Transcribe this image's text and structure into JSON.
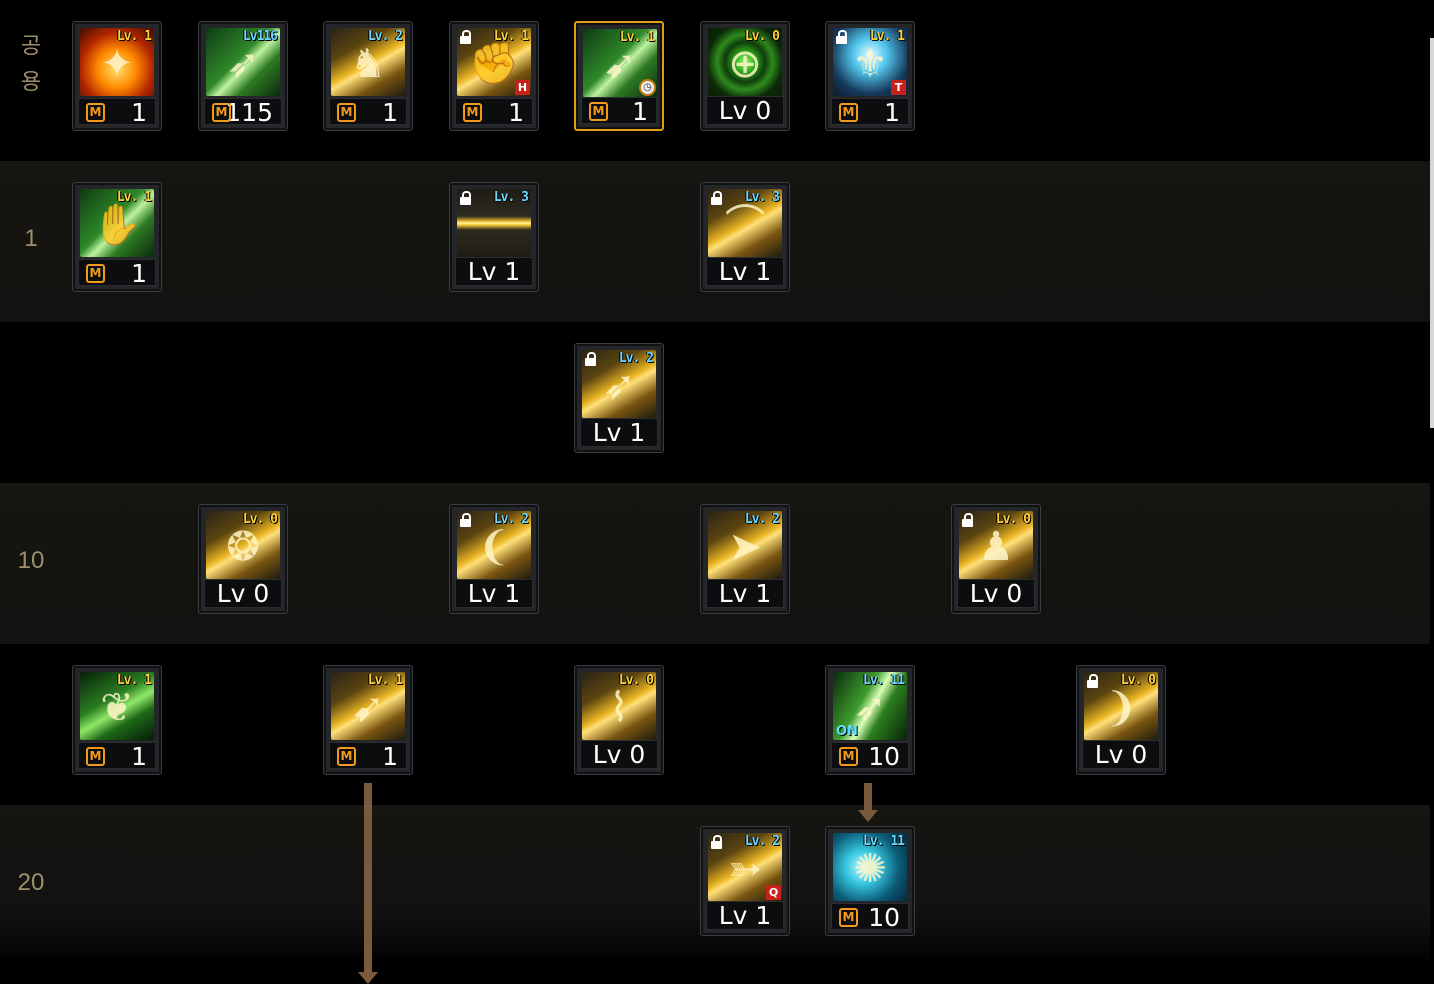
{
  "row_labels": [
    {
      "text": "공\n용",
      "vertical": true
    },
    {
      "text": "1"
    },
    {
      "text": ""
    },
    {
      "text": "10"
    },
    {
      "text": ""
    },
    {
      "text": "20"
    }
  ],
  "skills": [
    {
      "row": 0,
      "col": 0,
      "style": "fire",
      "glyph": "✦",
      "tag": "Lv. 1",
      "tag_color": "yellow",
      "locked": false,
      "m": true,
      "value": "1"
    },
    {
      "row": 0,
      "col": 1,
      "style": "green",
      "glyph": "➶",
      "tag": "Lv116",
      "tag_color": "blue",
      "locked": false,
      "m": true,
      "value": "115"
    },
    {
      "row": 0,
      "col": 2,
      "style": "gold",
      "glyph": "♞",
      "tag": "Lv. 2",
      "tag_color": "blue",
      "locked": false,
      "m": true,
      "value": "1"
    },
    {
      "row": 0,
      "col": 3,
      "style": "gold",
      "glyph": "✊",
      "tag": "Lv. 1",
      "tag_color": "yellow",
      "locked": true,
      "badge": "H",
      "badge_style": "red",
      "m": true,
      "value": "1"
    },
    {
      "row": 0,
      "col": 4,
      "style": "green",
      "glyph": "➹",
      "tag": "Lv. 1",
      "tag_color": "yellow",
      "locked": false,
      "badge": "◷",
      "badge_style": "clock",
      "selected": true,
      "m": true,
      "value": "1"
    },
    {
      "row": 0,
      "col": 5,
      "style": "target",
      "glyph": "⊕",
      "tag": "Lv. 0",
      "tag_color": "yellow",
      "locked": false,
      "m": false,
      "value": "Lv 0"
    },
    {
      "row": 0,
      "col": 6,
      "style": "angel",
      "glyph": "⚜",
      "tag": "Lv. 1",
      "tag_color": "yellow",
      "locked": true,
      "badge": "T",
      "badge_style": "red",
      "m": true,
      "value": "1"
    },
    {
      "row": 1,
      "col": 0,
      "style": "green",
      "glyph": "✋",
      "tag": "Lv. 1",
      "tag_color": "yellow",
      "locked": false,
      "m": true,
      "value": "1"
    },
    {
      "row": 1,
      "col": 3,
      "style": "goldline",
      "glyph": "",
      "tag": "Lv. 3",
      "tag_color": "blue",
      "locked": true,
      "m": false,
      "value": "Lv 1"
    },
    {
      "row": 1,
      "col": 5,
      "style": "gold",
      "glyph": "⌒",
      "tag": "Lv. 3",
      "tag_color": "blue",
      "locked": true,
      "m": false,
      "value": "Lv 1"
    },
    {
      "row": 2,
      "col": 4,
      "style": "gold",
      "glyph": "➶",
      "tag": "Lv. 2",
      "tag_color": "blue",
      "locked": true,
      "m": false,
      "value": "Lv 1"
    },
    {
      "row": 3,
      "col": 1,
      "style": "gold",
      "glyph": "❂",
      "tag": "Lv. 0",
      "tag_color": "yellow",
      "locked": false,
      "m": false,
      "value": "Lv 0"
    },
    {
      "row": 3,
      "col": 3,
      "style": "gold",
      "glyph": "❨",
      "tag": "Lv. 2",
      "tag_color": "blue",
      "locked": true,
      "m": false,
      "value": "Lv 1"
    },
    {
      "row": 3,
      "col": 5,
      "style": "gold",
      "glyph": "➤",
      "tag": "Lv. 2",
      "tag_color": "blue",
      "locked": false,
      "m": false,
      "value": "Lv 1"
    },
    {
      "row": 3,
      "col": 7,
      "style": "gold",
      "glyph": "♟",
      "tag": "Lv. 0",
      "tag_color": "yellow",
      "locked": true,
      "m": false,
      "value": "Lv 0"
    },
    {
      "row": 4,
      "col": 0,
      "style": "gleaf",
      "glyph": "❦",
      "tag": "Lv. 1",
      "tag_color": "yellow",
      "locked": false,
      "m": true,
      "value": "1"
    },
    {
      "row": 4,
      "col": 2,
      "style": "gold",
      "glyph": "➹",
      "tag": "Lv. 1",
      "tag_color": "yellow",
      "locked": false,
      "m": true,
      "value": "1"
    },
    {
      "row": 4,
      "col": 4,
      "style": "gold",
      "glyph": "⌇",
      "tag": "Lv. 0",
      "tag_color": "yellow",
      "locked": false,
      "m": false,
      "value": "Lv 0"
    },
    {
      "row": 4,
      "col": 6,
      "style": "greenbow",
      "glyph": "➶",
      "tag": "Lv. 11",
      "tag_color": "blue",
      "locked": false,
      "on": "ON",
      "m": true,
      "value": "10"
    },
    {
      "row": 4,
      "col": 8,
      "style": "gold",
      "glyph": "❩",
      "tag": "Lv. 0",
      "tag_color": "yellow",
      "locked": true,
      "m": false,
      "value": "Lv 0"
    },
    {
      "row": 5,
      "col": 5,
      "style": "gold",
      "glyph": "➳",
      "tag": "Lv. 2",
      "tag_color": "blue",
      "locked": true,
      "badge": "Q",
      "badge_style": "red",
      "m": false,
      "value": "Lv 1"
    },
    {
      "row": 5,
      "col": 6,
      "style": "teal",
      "glyph": "✺",
      "tag": "Lv. 11",
      "tag_color": "blue",
      "locked": false,
      "m": true,
      "value": "10"
    }
  ],
  "m_label": "M",
  "colors": {
    "accent": "#f39a1a",
    "connector": "#7a5a3a",
    "selected_border": "#e39a17"
  }
}
